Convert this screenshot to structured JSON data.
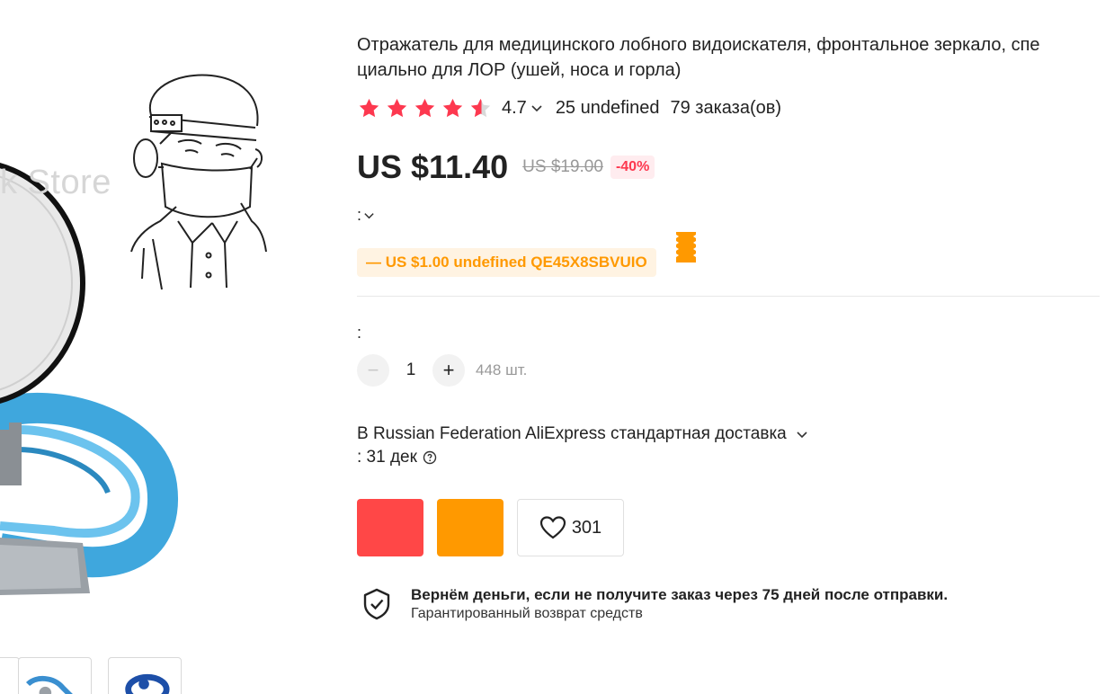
{
  "gallery": {
    "watermark": "k Store"
  },
  "product": {
    "title": "Отражатель для медицинского лобного видоискателя, фронтальное зеркало, спе циально для ЛОР (ушей, носа и горла)",
    "rating": {
      "stars": 4.7,
      "value": "4.7",
      "reviews": "25 undefined",
      "orders": "79 заказа(ов)"
    },
    "price": {
      "current": "US $11.40",
      "old": "US $19.00",
      "discount": "-40%"
    },
    "sku_label": ":",
    "coupon": {
      "text": "— US $1.00 undefined QE45X8SBVUIO"
    },
    "quantity": {
      "label": ":",
      "minus": "−",
      "plus": "+",
      "value": "1",
      "stock": "448 шт."
    },
    "shipping": {
      "method": "В Russian Federation AliExpress стандартная доставка",
      "delivery": ": 31 дек"
    },
    "wishlist": {
      "count": "301"
    },
    "guarantee": {
      "title": "Вернём деньги, если не получите заказ через 75 дней после отправки.",
      "subtitle": "Гарантированный возврат средств"
    }
  },
  "colors": {
    "star": "#fd384f",
    "buy": "#ff4747",
    "cart": "#ff9900",
    "coupon_bg": "#fff3e2",
    "coupon_text": "#ff9900",
    "discount": "#fd384f"
  },
  "icons": [
    "star-icon",
    "chevron-down-icon",
    "coupon-ticket-icon",
    "help-circle-icon",
    "heart-icon",
    "shield-check-icon"
  ]
}
